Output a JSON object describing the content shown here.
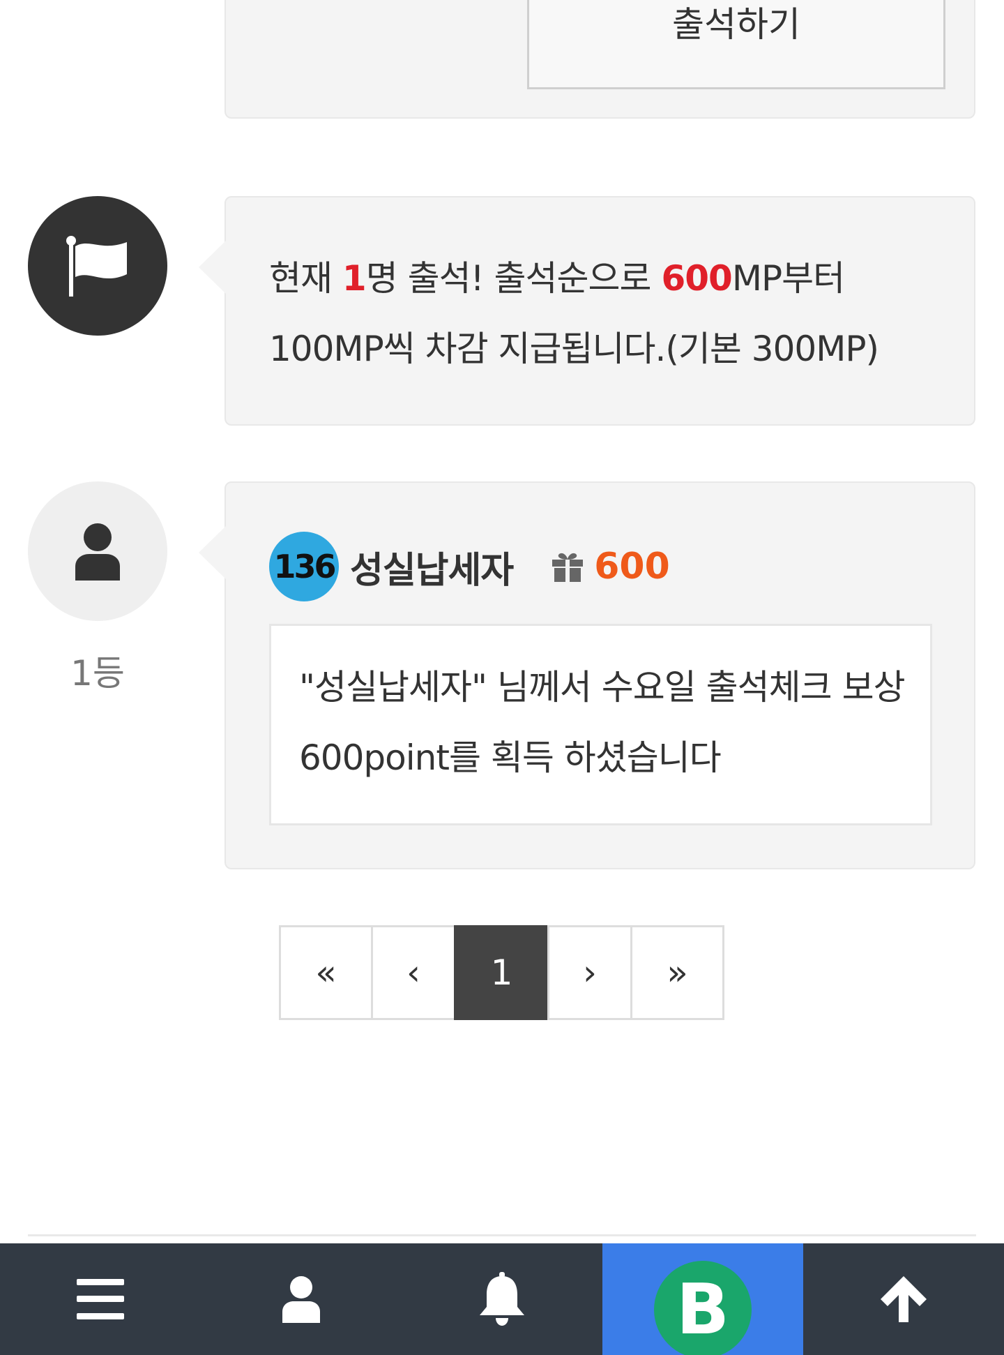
{
  "checkin": {
    "button_label": "출석하기"
  },
  "notice": {
    "text_1": "현재 ",
    "count": "1",
    "text_2": "명 출석! 출석순으로 ",
    "top_reward": "600",
    "text_3": "MP부터 100MP씩 차감 지급됩니다.(기본 300MP)"
  },
  "entry": {
    "rank": "1등",
    "level": "136",
    "username": "성실납세자",
    "points": "600",
    "message": "\"성실납세자\" 님께서 수요일 출석체크 보상 600point를 획득 하셨습니다"
  },
  "pagination": {
    "first": "«",
    "prev": "‹",
    "current": "1",
    "next": "›",
    "last": "»"
  },
  "colors": {
    "highlight_red": "#e0202a",
    "points_orange": "#ef5a1a",
    "nav_bg": "#323a44",
    "nav_active_bg": "#3b7de8",
    "logo_green": "#1aa66b"
  },
  "icons": {
    "flag": "flag-icon",
    "user": "user-icon",
    "gift": "gift-icon",
    "menu": "menu-icon",
    "bell": "bell-icon",
    "logo": "b-logo-icon",
    "top": "arrow-up-icon"
  },
  "bottom_nav": {
    "logo_letter": "B"
  }
}
